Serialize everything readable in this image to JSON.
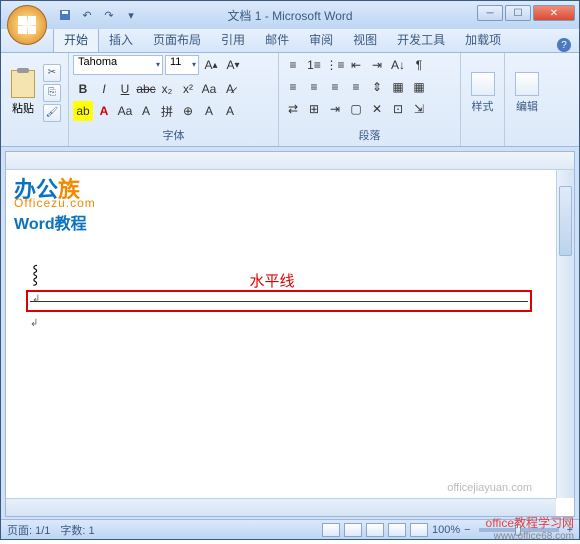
{
  "titlebar": {
    "doc_title": "文档 1 - Microsoft Word"
  },
  "tabs": {
    "items": [
      "开始",
      "插入",
      "页面布局",
      "引用",
      "邮件",
      "审阅",
      "视图",
      "开发工具",
      "加载项"
    ],
    "active_index": 0
  },
  "ribbon": {
    "clipboard": {
      "paste_label": "粘贴"
    },
    "font": {
      "group_label": "字体",
      "name": "Tahoma",
      "size": "11"
    },
    "paragraph": {
      "group_label": "段落"
    },
    "styles": {
      "group_label": "样式"
    },
    "editing": {
      "group_label": "编辑"
    }
  },
  "document": {
    "watermark_logo_a": "办公",
    "watermark_logo_b": "族",
    "watermark_domain": "Officezu.com",
    "watermark_tutorial": "Word教程",
    "annotation_label": "水平线",
    "bottom_watermark": "officejiayuan.com"
  },
  "statusbar": {
    "page": "页面: 1/1",
    "words": "字数: 1",
    "zoom": "100%"
  },
  "footer": {
    "site_name": "office教程学习网",
    "site_url": "www.office68.com"
  }
}
